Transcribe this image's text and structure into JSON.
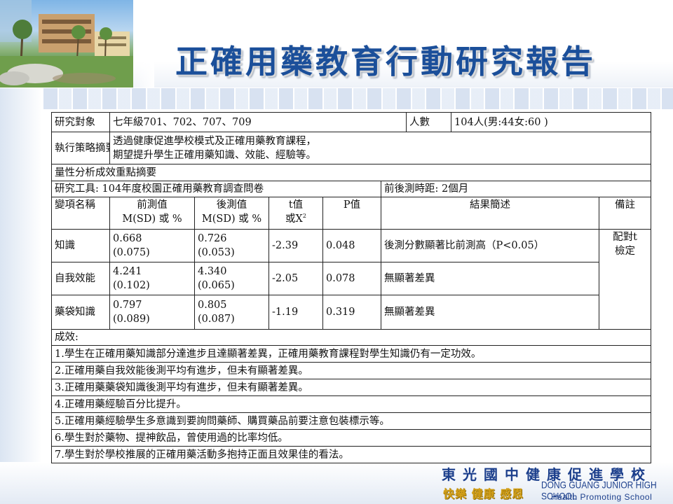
{
  "slide": {
    "title": "正確用藥教育行動研究報告"
  },
  "table": {
    "subject_label": "研究對象",
    "subject_value": "七年級701、702、707、709",
    "count_label": "人數",
    "count_value": "104人(男:44女:60 )",
    "strategy_label": "執行策略摘要",
    "strategy_line1": "透過健康促進學校模式及正確用藥教育課程，",
    "strategy_line2": "期望提升學生正確用藥知識、效能、經驗等。",
    "quant_summary": "量性分析成效重點摘要",
    "tool": "研究工具: 104年度校園正確用藥教育調查問卷",
    "interval": "前後測時距: 2個月",
    "headers": {
      "variable": "變項名稱",
      "pre_line1": "前測值",
      "pre_line2": "M(SD) 或 %",
      "post_line1": "後測值",
      "post_line2": "M(SD) 或 %",
      "t_line1": "t值",
      "t_line2": "或X",
      "t_sup": "2",
      "p": "P值",
      "result": "結果簡述",
      "remark": "備註"
    },
    "rows": [
      {
        "variable": "知識",
        "pre_mean": "0.668",
        "pre_sd": "(0.075)",
        "post_mean": "0.726",
        "post_sd": "(0.053)",
        "t": "-2.39",
        "p": "0.048",
        "result": "後測分數顯著比前測高（P<0.05）"
      },
      {
        "variable": "自我效能",
        "pre_mean": "4.241",
        "pre_sd": "(0.102)",
        "post_mean": "4.340",
        "post_sd": "(0.065)",
        "t": "-2.05",
        "p": "0.078",
        "result": "無顯著差異"
      },
      {
        "variable": "藥袋知識",
        "pre_mean": "0.797",
        "pre_sd": "(0.089)",
        "post_mean": "0.805",
        "post_sd": "(0.087)",
        "t": "-1.19",
        "p": "0.319",
        "result": "無顯著差異"
      }
    ],
    "remark_line1": "配對t",
    "remark_line2": "檢定",
    "outcomes_label": "成效:",
    "outcomes": [
      "1.學生在正確用藥知識部分達進步且達顯著差異，正確用藥教育課程對學生知識仍有一定功效。",
      "2.正確用藥自我效能後測平均有進步，但未有顯著差異。",
      "3.正確用藥藥袋知識後測平均有進步，但未有顯著差異。",
      "4.正確用藥經驗百分比提升。",
      "5.正確用藥經驗學生多意識到要詢問藥師、購買藥品前要注意包裝標示等。",
      "6.學生對於藥物、提神飲品，曾使用過的比率均低。",
      "7.學生對於學校推展的正確用藥活動多抱持正面且效果佳的看法。"
    ]
  },
  "footer": {
    "school_cn": "東光國中健康促進學校",
    "motto": "快樂 健康 感恩",
    "school_en": "DONG GUANG JUNIOR HIGH SCHOOL",
    "program_en": "Health Promoting School"
  }
}
